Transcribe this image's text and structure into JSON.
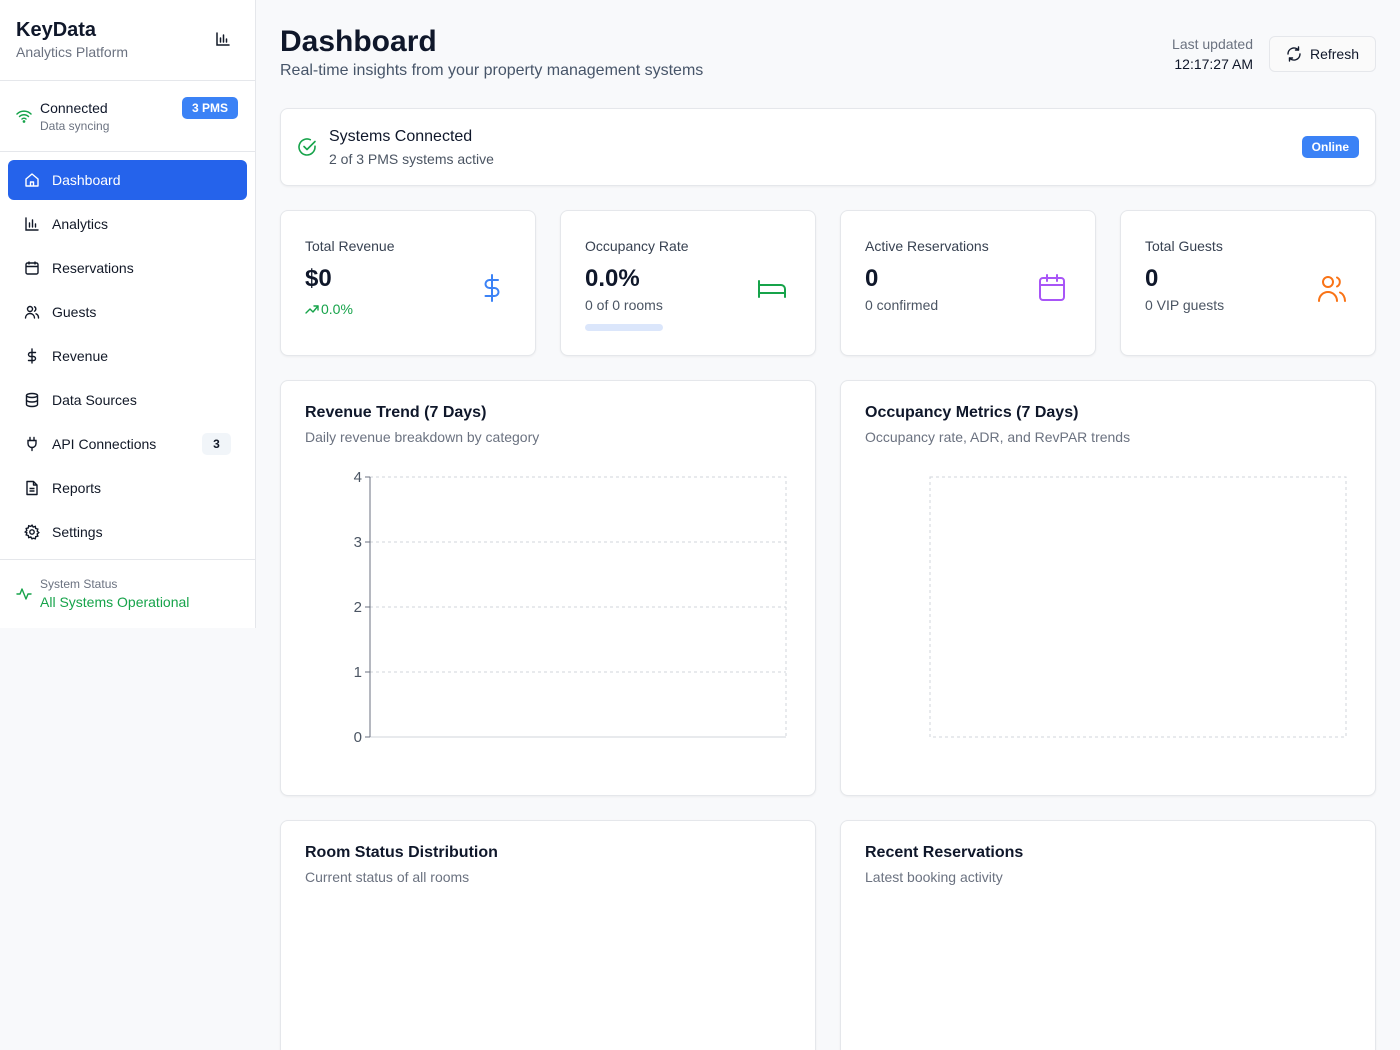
{
  "brand": {
    "name": "KeyData",
    "subtitle": "Analytics Platform"
  },
  "connection": {
    "title": "Connected",
    "subtitle": "Data syncing",
    "badge": "3 PMS"
  },
  "nav": [
    {
      "label": "Dashboard",
      "icon": "home-icon",
      "active": true
    },
    {
      "label": "Analytics",
      "icon": "bar-chart-icon"
    },
    {
      "label": "Reservations",
      "icon": "calendar-icon"
    },
    {
      "label": "Guests",
      "icon": "users-icon"
    },
    {
      "label": "Revenue",
      "icon": "dollar-icon"
    },
    {
      "label": "Data Sources",
      "icon": "database-icon"
    },
    {
      "label": "API Connections",
      "icon": "plug-icon",
      "count": "3"
    },
    {
      "label": "Reports",
      "icon": "file-icon"
    },
    {
      "label": "Settings",
      "icon": "gear-icon"
    }
  ],
  "system_status": {
    "label": "System Status",
    "value": "All Systems Operational"
  },
  "header": {
    "title": "Dashboard",
    "subtitle": "Real-time insights from your property management systems",
    "last_updated_label": "Last updated",
    "last_updated_time": "12:17:27 AM",
    "refresh_label": "Refresh"
  },
  "systems": {
    "title": "Systems Connected",
    "subtitle": "2 of 3 PMS systems active",
    "badge": "Online"
  },
  "stats": {
    "revenue": {
      "label": "Total Revenue",
      "value": "$0",
      "trend": "0.0%"
    },
    "occupancy": {
      "label": "Occupancy Rate",
      "value": "0.0%",
      "sub": "0 of 0 rooms",
      "progress": 0
    },
    "reservations": {
      "label": "Active Reservations",
      "value": "0",
      "sub": "0 confirmed"
    },
    "guests": {
      "label": "Total Guests",
      "value": "0",
      "sub": "0 VIP guests"
    }
  },
  "colors": {
    "primary": "#2563eb",
    "green": "#16a34a",
    "purple": "#a855f7",
    "orange": "#f97316",
    "blue_icon": "#3b82f6"
  },
  "revenue_chart": {
    "title": "Revenue Trend (7 Days)",
    "subtitle": "Daily revenue breakdown by category"
  },
  "occupancy_chart": {
    "title": "Occupancy Metrics (7 Days)",
    "subtitle": "Occupancy rate, ADR, and RevPAR trends"
  },
  "room_status": {
    "title": "Room Status Distribution",
    "subtitle": "Current status of all rooms"
  },
  "recent_reservations": {
    "title": "Recent Reservations",
    "subtitle": "Latest booking activity"
  },
  "chart_data": [
    {
      "type": "bar",
      "categories": [],
      "series": [],
      "ylim": [
        0,
        4
      ],
      "yticks": [
        "0",
        "1",
        "2",
        "3",
        "4"
      ],
      "grid": true
    },
    {
      "type": "line",
      "categories": [],
      "series": [],
      "grid": true
    }
  ]
}
